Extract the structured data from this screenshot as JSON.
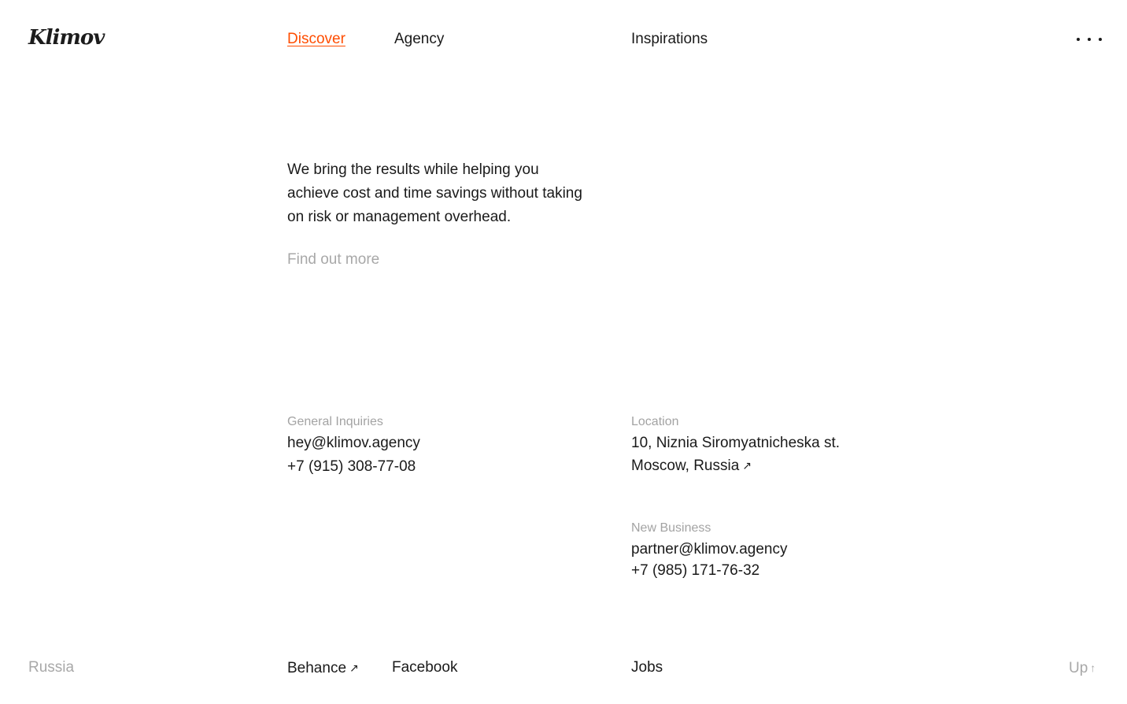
{
  "logo": {
    "text": "Klimov"
  },
  "nav": {
    "discover": "Discover",
    "agency": "Agency",
    "inspirations": "Inspirations"
  },
  "intro": {
    "text": "We bring the results while helping you achieve cost and time savings without taking on risk or management overhead.",
    "cta": "Find out more"
  },
  "contacts": {
    "general": {
      "label": "General Inquiries",
      "email": "hey@klimov.agency",
      "phone": "+7 (915) 308-77-08"
    },
    "location": {
      "label": "Location",
      "street": "10, Niznia Siromyatnicheska st.",
      "city": "Moscow, Russia"
    },
    "new_business": {
      "label": "New Business",
      "email": "partner@klimov.agency",
      "phone": "+7 (985) 171-76-32"
    }
  },
  "footer": {
    "country": "Russia",
    "behance": "Behance",
    "facebook": "Facebook",
    "jobs": "Jobs",
    "up": "Up"
  },
  "icons": {
    "external_arrow": "↗",
    "up_arrow": "↑"
  },
  "colors": {
    "accent": "#ff4d00",
    "text": "#1a1a1a",
    "muted": "#a8a8a8",
    "background": "#ffffff"
  }
}
